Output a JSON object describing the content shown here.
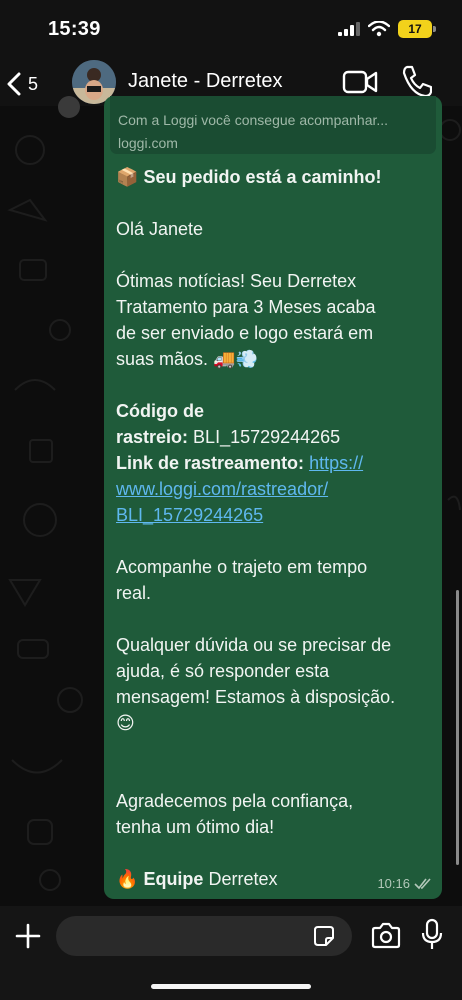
{
  "status_bar": {
    "time": "15:39",
    "battery": "17"
  },
  "header": {
    "back_count": "5",
    "contact_name": "Janete - Derretex"
  },
  "message": {
    "preview_description": "Com a Loggi você consegue acompanhar...",
    "preview_domain": "loggi.com",
    "title_emoji": "📦",
    "title": "Seu pedido está a caminho!",
    "greeting": "Olá Janete",
    "body_lines": [
      "Ótimas notícias! Seu Derretex",
      "Tratamento para 3 Meses acaba",
      "de ser enviado e logo estará em",
      "suas mãos."
    ],
    "body_emojis": "🚚💨",
    "tracking_label_1": "Código de",
    "tracking_label_2": "rastreio:",
    "tracking_code": "BLI_15729244265",
    "tracking_link_label": "Link de rastreamento:",
    "tracking_link_1": "https://",
    "tracking_link_2": "www.loggi.com/rastreador/",
    "tracking_link_3": "BLI_15729244265",
    "follow_1": "Acompanhe o trajeto em tempo",
    "follow_2": "real.",
    "help_1": "Qualquer dúvida ou se precisar de",
    "help_2": "ajuda, é só responder esta",
    "help_3": "mensagem! Estamos à disposição.",
    "help_emoji": "😊",
    "thanks_1": "Agradecemos pela confiança,",
    "thanks_2": "tenha um ótimo dia!",
    "signature_emoji": "🔥",
    "signature_bold": "Equipe",
    "signature_rest": "Derretex",
    "time": "10:16"
  },
  "composer": {
    "placeholder": ""
  },
  "colors": {
    "bubble": "#1f5b3a",
    "link": "#5fb8ef",
    "battery": "#f2d21b"
  },
  "icons": [
    "back-chevron-icon",
    "video-call-icon",
    "phone-icon",
    "plus-icon",
    "sticker-icon",
    "camera-icon",
    "microphone-icon",
    "double-check-icon",
    "signal-icon",
    "wifi-icon"
  ]
}
